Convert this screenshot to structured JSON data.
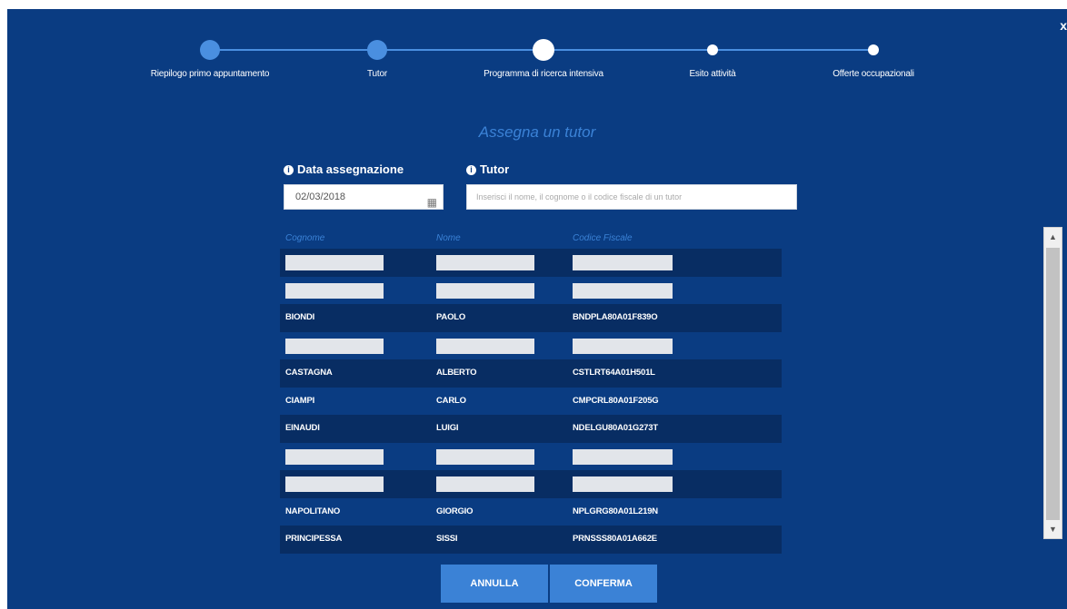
{
  "close_label": "x",
  "stepper": {
    "steps": [
      {
        "label": "Riepilogo primo appuntamento",
        "state": "done"
      },
      {
        "label": "Tutor",
        "state": "done"
      },
      {
        "label": "Programma di ricerca intensiva",
        "state": "current"
      },
      {
        "label": "Esito attività",
        "state": "future"
      },
      {
        "label": "Offerte occupazionali",
        "state": "future"
      }
    ]
  },
  "title": "Assegna un tutor",
  "form": {
    "date_label": "Data assegnazione",
    "date_value": "02/03/2018",
    "tutor_label": "Tutor",
    "tutor_placeholder": "Inserisci il nome, il cognome o il codice fiscale di un tutor"
  },
  "table": {
    "headers": [
      "Cognome",
      "Nome",
      "Codice Fiscale"
    ],
    "rows": [
      {
        "redacted": true
      },
      {
        "redacted": true
      },
      {
        "cognome": "BIONDI",
        "nome": "PAOLO",
        "cf": "BNDPLA80A01F839O"
      },
      {
        "redacted": true
      },
      {
        "cognome": "CASTAGNA",
        "nome": "ALBERTO",
        "cf": "CSTLRT64A01H501L"
      },
      {
        "cognome": "CIAMPI",
        "nome": "CARLO",
        "cf": "CMPCRL80A01F205G"
      },
      {
        "cognome": "EINAUDI",
        "nome": "LUIGI",
        "cf": "NDELGU80A01G273T"
      },
      {
        "redacted": true
      },
      {
        "redacted": true
      },
      {
        "cognome": "NAPOLITANO",
        "nome": "GIORGIO",
        "cf": "NPLGRG80A01L219N"
      },
      {
        "cognome": "PRINCIPESSA",
        "nome": "SISSI",
        "cf": "PRNSSS80A01A662E"
      }
    ]
  },
  "buttons": {
    "cancel": "ANNULLA",
    "confirm": "CONFERMA"
  },
  "icons": {
    "info": "info-icon",
    "calendar": "calendar-icon"
  },
  "colors": {
    "background": "#0a3c82",
    "accent": "#3b82d6"
  }
}
